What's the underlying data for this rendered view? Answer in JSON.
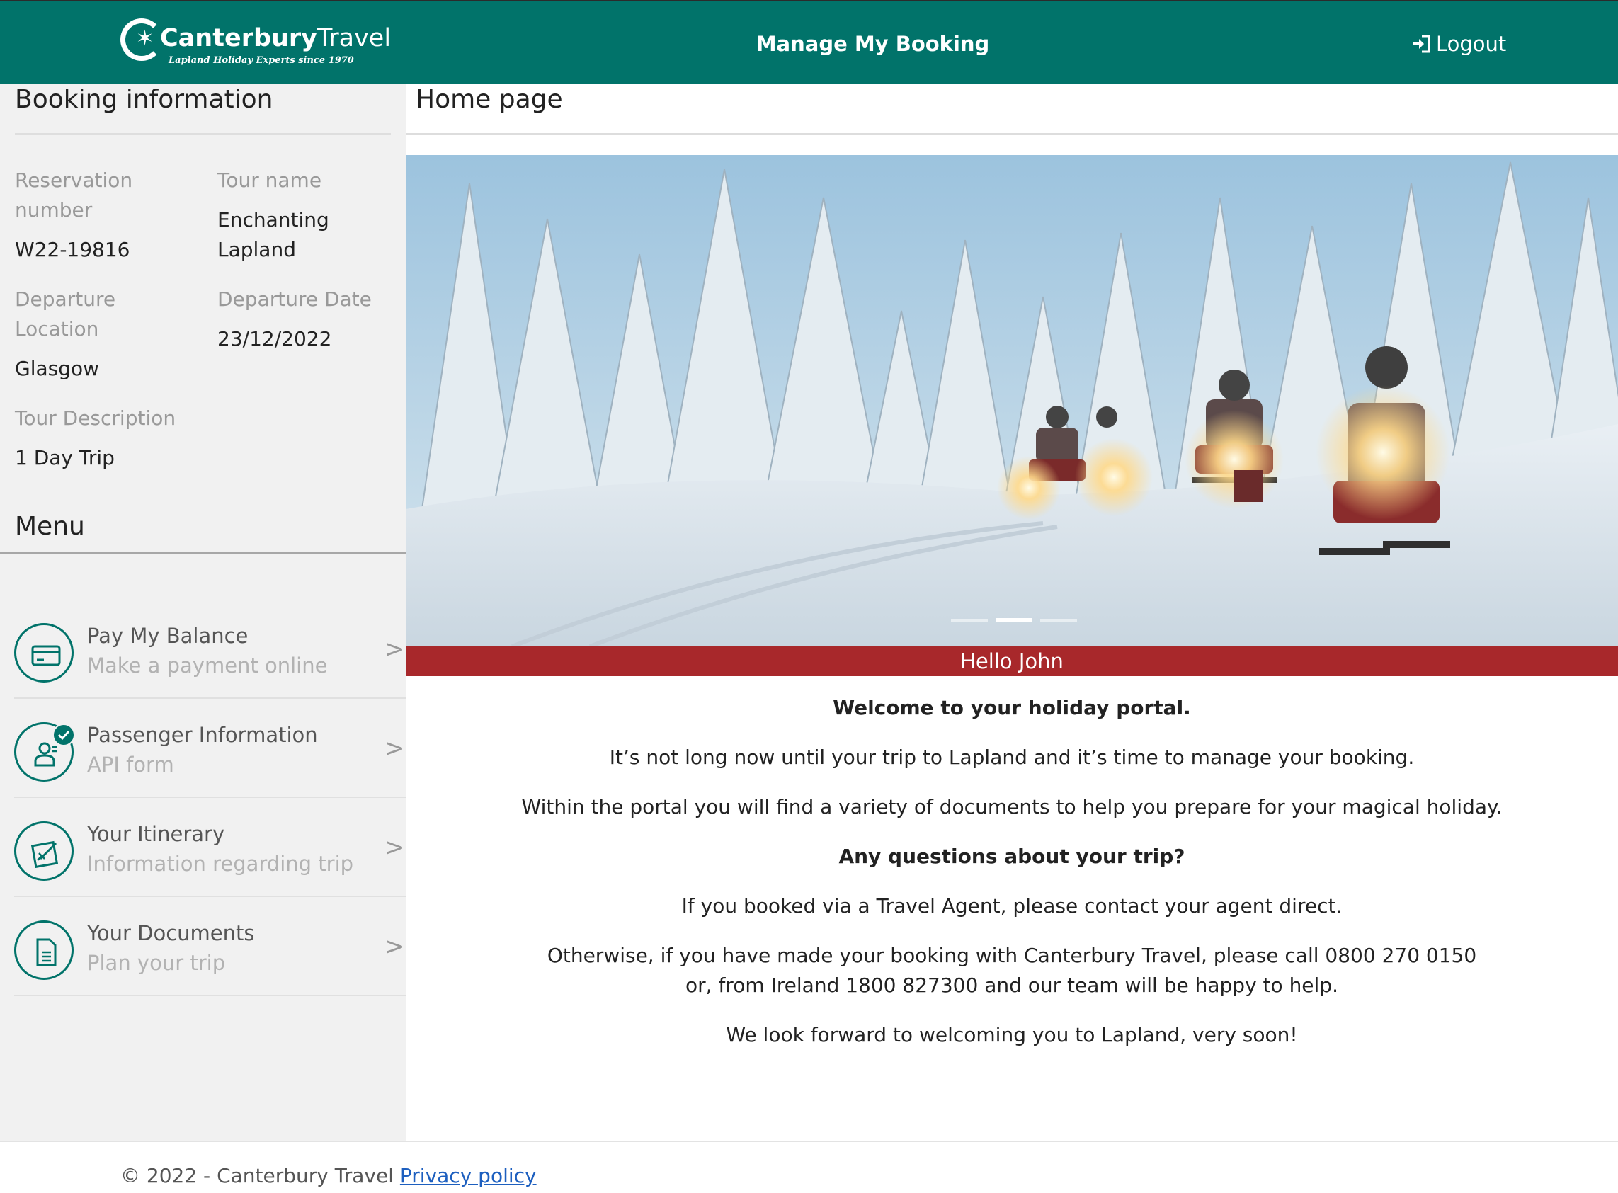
{
  "header": {
    "logo_name": "Canterbury",
    "logo_name_thin": "Travel",
    "logo_tagline": "Lapland Holiday Experts since 1970",
    "title": "Manage My Booking",
    "logout_label": "Logout",
    "color": "#01736a"
  },
  "booking": {
    "heading": "Booking information",
    "reservation_label": "Reservation number",
    "reservation_value": "W22-19816",
    "tour_name_label": "Tour name",
    "tour_name_value": "Enchanting Lapland",
    "departure_location_label": "Departure Location",
    "departure_location_value": "Glasgow",
    "departure_date_label": "Departure Date",
    "departure_date_value": "23/12/2022",
    "tour_description_label": "Tour Description",
    "tour_description_value": "1 Day Trip"
  },
  "menu": {
    "heading": "Menu",
    "items": [
      {
        "title": "Pay My Balance",
        "subtitle": "Make a payment online",
        "icon": "credit-card-icon"
      },
      {
        "title": "Passenger Information",
        "subtitle": "API form",
        "icon": "passenger-icon",
        "status": "completed"
      },
      {
        "title": "Your Itinerary",
        "subtitle": "Information regarding trip",
        "icon": "itinerary-icon"
      },
      {
        "title": "Your Documents",
        "subtitle": "Plan your trip",
        "icon": "document-icon"
      }
    ],
    "chevron": ">"
  },
  "main": {
    "page_title": "Home page",
    "carousel": {
      "slides": 3,
      "active_slide": 2
    },
    "greeting": "Hello John",
    "greeting_color": "#a8282b",
    "welcome": "Welcome to your holiday portal.",
    "line1": "It’s not long now until your trip to Lapland and it’s time to manage your booking.",
    "line2": "Within the portal you will find a variety of documents to help you prepare for your magical holiday.",
    "questions": "Any questions about your trip?",
    "line3": "If you booked via a Travel Agent, please contact your agent direct.",
    "line4a": "Otherwise, if you have made your booking with Canterbury Travel, please call 0800 270 0150",
    "line4b": "or, from Ireland 1800 827300 and our team will be happy to help.",
    "line5": "We look forward to welcoming you to Lapland, very soon!"
  },
  "footer": {
    "copyright": "© 2022 - Canterbury Travel",
    "privacy_label": "Privacy policy"
  }
}
